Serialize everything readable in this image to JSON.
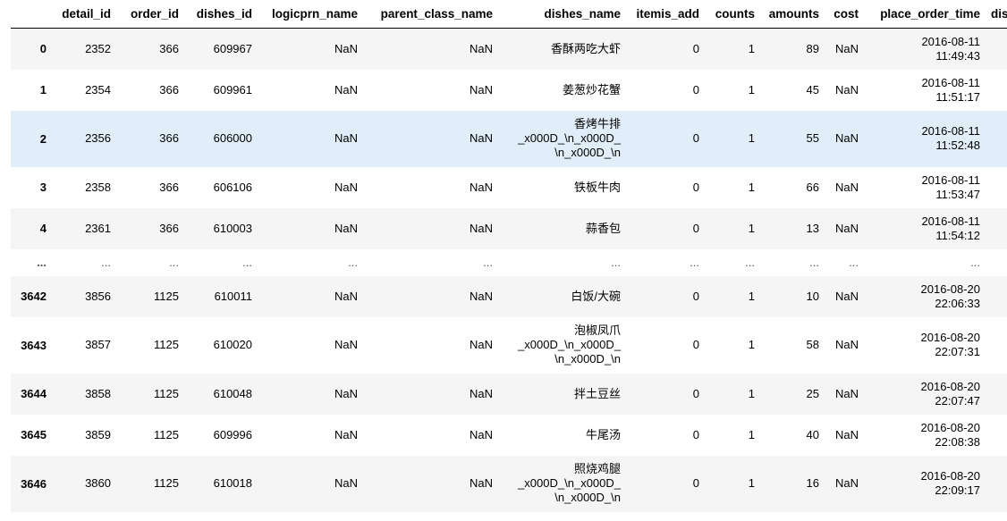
{
  "table": {
    "index_header": "",
    "columns": [
      "detail_id",
      "order_id",
      "dishes_id",
      "logicprn_name",
      "parent_class_name",
      "dishes_name",
      "itemis_add",
      "counts",
      "amounts",
      "cost",
      "place_order_time",
      "discount_amt"
    ],
    "rows": [
      {
        "index": "0",
        "cells": [
          "2352",
          "366",
          "609967",
          "NaN",
          "NaN",
          "香酥两吃大虾",
          "0",
          "1",
          "89",
          "NaN",
          "2016-08-11\n11:49:43",
          ""
        ]
      },
      {
        "index": "1",
        "cells": [
          "2354",
          "366",
          "609961",
          "NaN",
          "NaN",
          "姜葱炒花蟹",
          "0",
          "1",
          "45",
          "NaN",
          "2016-08-11\n11:51:17",
          ""
        ]
      },
      {
        "index": "2",
        "cells": [
          "2356",
          "366",
          "606000",
          "NaN",
          "NaN",
          "香烤牛排\n_x000D_\\n_x000D_\n\\n_x000D_\\n",
          "0",
          "1",
          "55",
          "NaN",
          "2016-08-11\n11:52:48",
          ""
        ]
      },
      {
        "index": "3",
        "cells": [
          "2358",
          "366",
          "606106",
          "NaN",
          "NaN",
          "铁板牛肉",
          "0",
          "1",
          "66",
          "NaN",
          "2016-08-11\n11:53:47",
          ""
        ]
      },
      {
        "index": "4",
        "cells": [
          "2361",
          "366",
          "610003",
          "NaN",
          "NaN",
          "蒜香包",
          "0",
          "1",
          "13",
          "NaN",
          "2016-08-11\n11:54:12",
          ""
        ]
      },
      {
        "index": "...",
        "cells": [
          "...",
          "...",
          "...",
          "...",
          "...",
          "...",
          "...",
          "...",
          "...",
          "...",
          "...",
          ""
        ]
      },
      {
        "index": "3642",
        "cells": [
          "3856",
          "1125",
          "610011",
          "NaN",
          "NaN",
          "白饭/大碗",
          "0",
          "1",
          "10",
          "NaN",
          "2016-08-20\n22:06:33",
          ""
        ]
      },
      {
        "index": "3643",
        "cells": [
          "3857",
          "1125",
          "610020",
          "NaN",
          "NaN",
          "泡椒凤爪\n_x000D_\\n_x000D_\n\\n_x000D_\\n",
          "0",
          "1",
          "58",
          "NaN",
          "2016-08-20\n22:07:31",
          ""
        ]
      },
      {
        "index": "3644",
        "cells": [
          "3858",
          "1125",
          "610048",
          "NaN",
          "NaN",
          "拌土豆丝",
          "0",
          "1",
          "25",
          "NaN",
          "2016-08-20\n22:07:47",
          ""
        ]
      },
      {
        "index": "3645",
        "cells": [
          "3859",
          "1125",
          "609996",
          "NaN",
          "NaN",
          "牛尾汤",
          "0",
          "1",
          "40",
          "NaN",
          "2016-08-20\n22:08:38",
          ""
        ]
      },
      {
        "index": "3646",
        "cells": [
          "3860",
          "1125",
          "610018",
          "NaN",
          "NaN",
          "照烧鸡腿\n_x000D_\\n_x000D_\n\\n_x000D_\\n",
          "0",
          "1",
          "16",
          "NaN",
          "2016-08-20\n22:09:17",
          ""
        ]
      }
    ]
  },
  "colors": {
    "striped_row": "#f5f5f5",
    "hover_row": "#e1eefa",
    "header_rule": "#000000"
  }
}
